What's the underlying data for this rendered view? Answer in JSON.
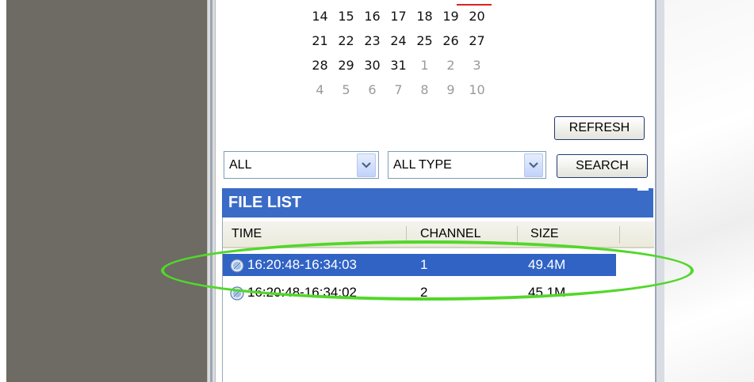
{
  "calendar": {
    "rows": [
      [
        {
          "d": "14",
          "m": false
        },
        {
          "d": "15",
          "m": false
        },
        {
          "d": "16",
          "m": false
        },
        {
          "d": "17",
          "m": false
        },
        {
          "d": "18",
          "m": false
        },
        {
          "d": "19",
          "m": false
        },
        {
          "d": "20",
          "m": false
        }
      ],
      [
        {
          "d": "21",
          "m": false
        },
        {
          "d": "22",
          "m": false
        },
        {
          "d": "23",
          "m": false
        },
        {
          "d": "24",
          "m": false
        },
        {
          "d": "25",
          "m": false
        },
        {
          "d": "26",
          "m": false
        },
        {
          "d": "27",
          "m": false
        }
      ],
      [
        {
          "d": "28",
          "m": false
        },
        {
          "d": "29",
          "m": false
        },
        {
          "d": "30",
          "m": false
        },
        {
          "d": "31",
          "m": false
        },
        {
          "d": "1",
          "m": true
        },
        {
          "d": "2",
          "m": true
        },
        {
          "d": "3",
          "m": true
        }
      ],
      [
        {
          "d": "4",
          "m": true
        },
        {
          "d": "5",
          "m": true
        },
        {
          "d": "6",
          "m": true
        },
        {
          "d": "7",
          "m": true
        },
        {
          "d": "8",
          "m": true
        },
        {
          "d": "9",
          "m": true
        },
        {
          "d": "10",
          "m": true
        }
      ]
    ],
    "today_marker_color": "#dd2222"
  },
  "controls": {
    "refresh_label": "REFRESH",
    "channel_select_value": "ALL",
    "type_select_value": "ALL TYPE",
    "search_label": "SEARCH"
  },
  "file_list": {
    "title": "FILE LIST",
    "columns": {
      "time": "TIME",
      "channel": "CHANNEL",
      "size": "SIZE"
    },
    "rows": [
      {
        "time": "16:20:48-16:34:03",
        "channel": "1",
        "size": "49.4M",
        "selected": true,
        "icon": "video-file-icon"
      },
      {
        "time": "16:20:48-16:34:02",
        "channel": "2",
        "size": "45.1M",
        "selected": false,
        "icon": "video-file-icon"
      }
    ]
  },
  "colors": {
    "header_blue": "#3a6bc6",
    "selection_blue": "#3163c5",
    "highlight_green": "#52d72a",
    "left_pane": "#6d6b63"
  }
}
